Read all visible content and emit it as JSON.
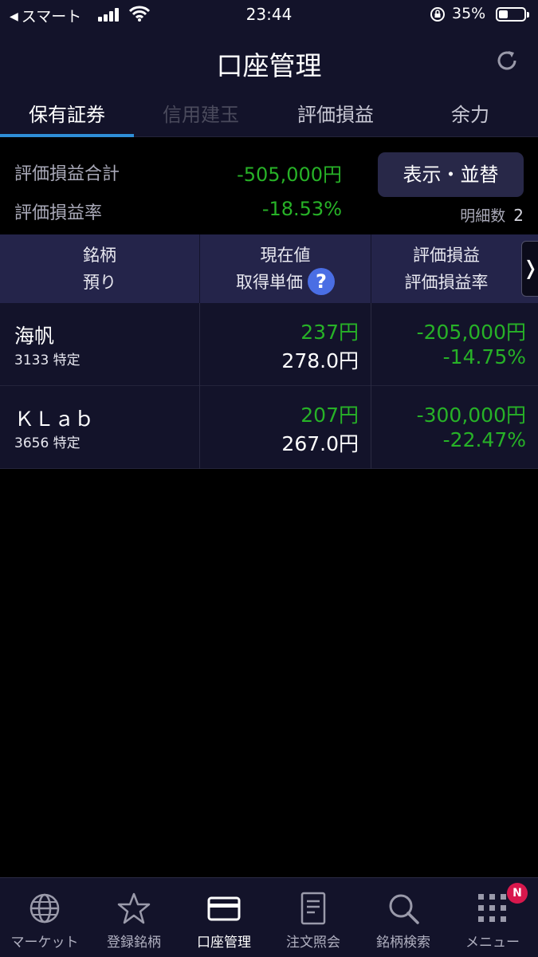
{
  "status_bar": {
    "carrier": "スマート",
    "time": "23:44",
    "battery": "35%"
  },
  "nav": {
    "title": "口座管理"
  },
  "tabs": [
    "保有証券",
    "信用建玉",
    "評価損益",
    "余力"
  ],
  "summary": {
    "total_label": "評価損益合計",
    "total_value": "-505,000円",
    "rate_label": "評価損益率",
    "rate_value": "-18.53%",
    "display_button": "表示・並替",
    "count_label": "明細数",
    "count_value": "2"
  },
  "table_header": {
    "col1_line1": "銘柄",
    "col1_line2": "預り",
    "col2_line1": "現在値",
    "col2_line2": "取得単価",
    "col3_line1": "評価損益",
    "col3_line2": "評価損益率"
  },
  "rows": [
    {
      "name": "海帆",
      "code": "3133 特定",
      "current": "237円",
      "acquired": "278.0円",
      "pl": "-205,000円",
      "rate": "-14.75%"
    },
    {
      "name": "ＫＬａｂ",
      "code": "3656 特定",
      "current": "207円",
      "acquired": "267.0円",
      "pl": "-300,000円",
      "rate": "-22.47%"
    }
  ],
  "bottom_nav": [
    {
      "label": "マーケット",
      "icon": "globe-icon"
    },
    {
      "label": "登録銘柄",
      "icon": "star-icon"
    },
    {
      "label": "口座管理",
      "icon": "card-icon"
    },
    {
      "label": "注文照会",
      "icon": "document-icon"
    },
    {
      "label": "銘柄検索",
      "icon": "search-icon"
    },
    {
      "label": "メニュー",
      "icon": "grid-icon",
      "badge": "N"
    }
  ],
  "colors": {
    "background": "#000000",
    "header": "#13132a",
    "accent": "#2f8fd8",
    "positive_green": "#27b227",
    "badge": "#d8184d"
  }
}
